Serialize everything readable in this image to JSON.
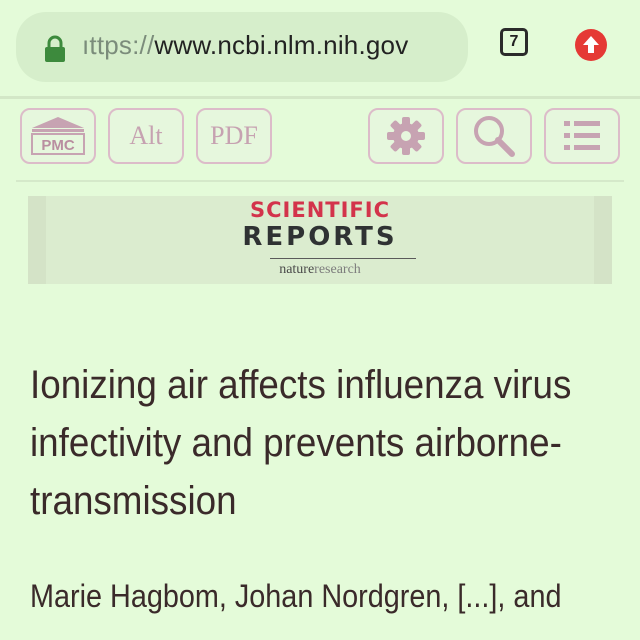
{
  "browser": {
    "url_protocol": "ıttps://",
    "url_host": "www.ncbi.nlm.nih.gov",
    "tab_count": "7",
    "lock_icon": "lock-icon",
    "update_icon": "arrow-up-circle-icon",
    "update_color": "#e53935"
  },
  "toolbar": {
    "pmc_label": "PMC",
    "alt_label": "Alt",
    "pdf_label": "PDF",
    "settings_icon": "gear-icon",
    "search_icon": "magnifier-icon",
    "menu_icon": "list-icon",
    "accent_color": "#c7a3b2"
  },
  "journal": {
    "line1": "SCIENTIFIC",
    "line2": "REPORTS",
    "publisher_bold": "nature",
    "publisher_light": "research"
  },
  "article": {
    "title": "Ionizing air affects influenza virus infectivity and prevents airborne-transmission",
    "authors": "Marie Hagbom, Johan Nordgren, [...], and"
  }
}
